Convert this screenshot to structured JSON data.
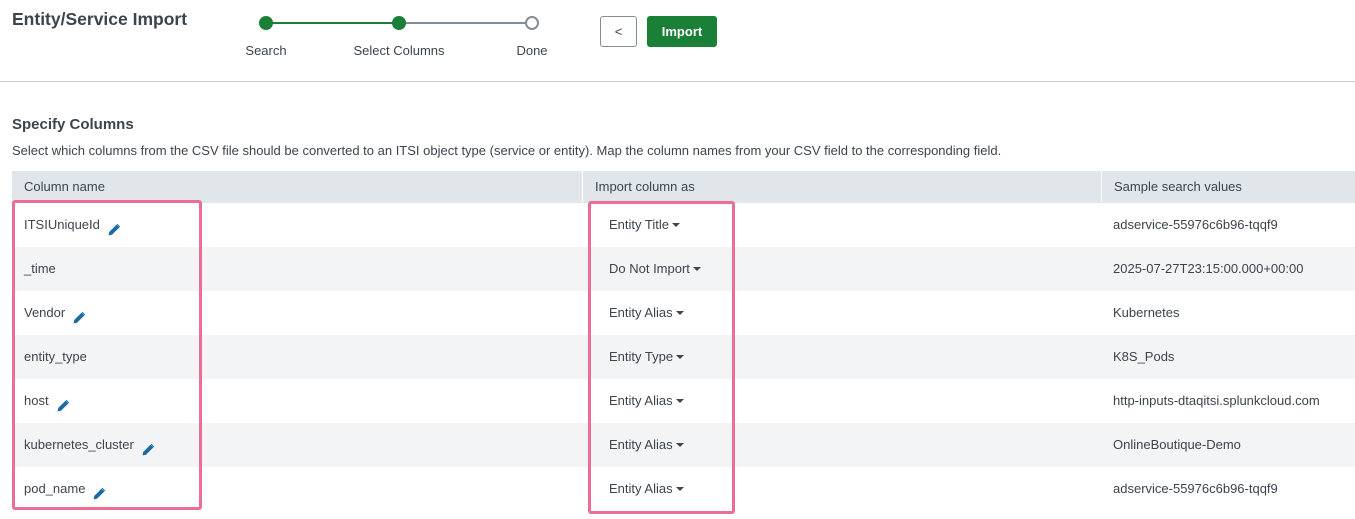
{
  "header": {
    "title": "Entity/Service Import",
    "back_label": "<",
    "import_label": "Import"
  },
  "stepper": {
    "steps": [
      {
        "label": "Search",
        "state": "complete"
      },
      {
        "label": "Select Columns",
        "state": "current"
      },
      {
        "label": "Done",
        "state": "pending"
      }
    ]
  },
  "section": {
    "title": "Specify Columns",
    "description": "Select which columns from the CSV file should be converted to an ITSI object type (service or entity). Map the column names from your CSV field to the corresponding field."
  },
  "table": {
    "columns": [
      "Column name",
      "Import column as",
      "Sample search values"
    ],
    "rows": [
      {
        "name": "ITSIUniqueId",
        "editable": true,
        "import_as": "Entity Title",
        "sample": "adservice-55976c6b96-tqqf9"
      },
      {
        "name": "_time",
        "editable": false,
        "import_as": "Do Not Import",
        "sample": "2025-07-27T23:15:00.000+00:00"
      },
      {
        "name": "Vendor",
        "editable": true,
        "import_as": "Entity Alias",
        "sample": "Kubernetes"
      },
      {
        "name": "entity_type",
        "editable": false,
        "import_as": "Entity Type",
        "sample": "K8S_Pods"
      },
      {
        "name": "host",
        "editable": true,
        "import_as": "Entity Alias",
        "sample": "http-inputs-dtaqitsi.splunkcloud.com"
      },
      {
        "name": "kubernetes_cluster",
        "editable": true,
        "import_as": "Entity Alias",
        "sample": "OnlineBoutique-Demo"
      },
      {
        "name": "pod_name",
        "editable": true,
        "import_as": "Entity Alias",
        "sample": "adservice-55976c6b96-tqqf9"
      }
    ]
  },
  "icons": {
    "edit": "pencil-icon",
    "dropdown": "caret-down-icon"
  },
  "colors": {
    "primary_green": "#1a7f37",
    "highlight_pink": "#ec6e97",
    "header_gray": "#e1e6eb",
    "row_alt": "#f2f4f5",
    "edit_icon_blue": "#1a6aa5"
  }
}
